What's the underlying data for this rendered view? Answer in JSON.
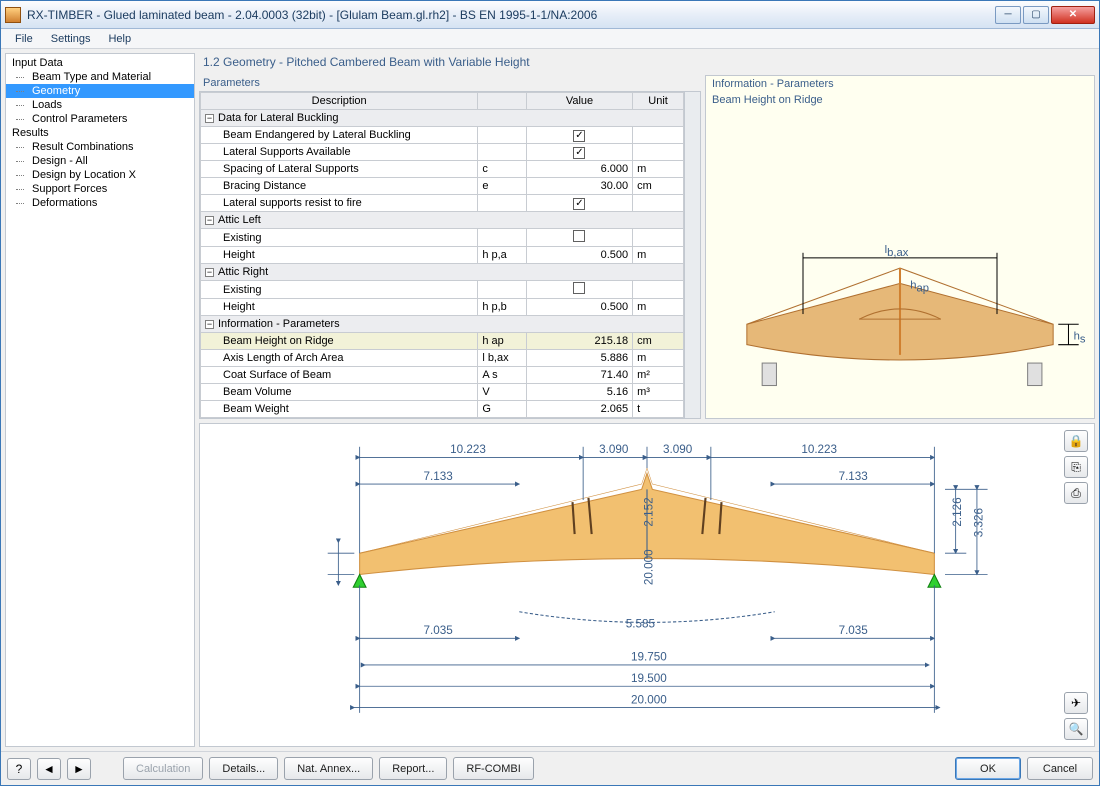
{
  "window": {
    "title": "RX-TIMBER - Glued laminated beam - 2.04.0003 (32bit) - [Glulam Beam.gl.rh2] - BS EN 1995-1-1/NA:2006"
  },
  "menu": {
    "file": "File",
    "settings": "Settings",
    "help": "Help"
  },
  "nav": {
    "input": "Input Data",
    "items_input": [
      "Beam Type and Material",
      "Geometry",
      "Loads",
      "Control Parameters"
    ],
    "results": "Results",
    "items_results": [
      "Result Combinations",
      "Design - All",
      "Design by Location X",
      "Support Forces",
      "Deformations"
    ]
  },
  "page": {
    "title": "1.2 Geometry  -  Pitched Cambered Beam with Variable Height",
    "parameters": "Parameters"
  },
  "cols": {
    "desc": "Description",
    "sym": "",
    "val": "Value",
    "unit": "Unit"
  },
  "groups": {
    "lateral": "Data for Lateral Buckling",
    "atticL": "Attic Left",
    "atticR": "Attic Right",
    "info": "Information - Parameters"
  },
  "rows": {
    "endangered": {
      "d": "Beam Endangered by Lateral Buckling",
      "cb": true
    },
    "supports_avail": {
      "d": "Lateral Supports Available",
      "cb": true
    },
    "spacing": {
      "d": "Spacing of Lateral Supports",
      "s": "c",
      "v": "6.000",
      "u": "m"
    },
    "bracing": {
      "d": "Bracing Distance",
      "s": "e",
      "v": "30.00",
      "u": "cm"
    },
    "fire": {
      "d": "Lateral supports resist to fire",
      "cb": true
    },
    "aL_exist": {
      "d": "Existing",
      "cb": false
    },
    "aL_height": {
      "d": "Height",
      "s": "h p,a",
      "v": "0.500",
      "u": "m"
    },
    "aR_exist": {
      "d": "Existing",
      "cb": false
    },
    "aR_height": {
      "d": "Height",
      "s": "h p,b",
      "v": "0.500",
      "u": "m"
    },
    "ridge": {
      "d": "Beam Height on Ridge",
      "s": "h ap",
      "v": "215.18",
      "u": "cm"
    },
    "axis": {
      "d": "Axis Length of Arch Area",
      "s": "l b,ax",
      "v": "5.886",
      "u": "m"
    },
    "coat": {
      "d": "Coat Surface of Beam",
      "s": "A s",
      "v": "71.40",
      "u": "m²"
    },
    "vol": {
      "d": "Beam Volume",
      "s": "V",
      "v": "5.16",
      "u": "m³"
    },
    "weight": {
      "d": "Beam Weight",
      "s": "G",
      "v": "2.065",
      "u": "t"
    }
  },
  "info": {
    "title": "Information - Parameters",
    "sub": "Beam Height on Ridge",
    "labels": {
      "lbax": "l",
      "lbax_sub": "b,ax",
      "hap": "h",
      "hap_sub": "ap",
      "hs": "h",
      "hs_sub": "s"
    }
  },
  "dims": {
    "top": [
      "10.223",
      "3.090",
      "3.090",
      "10.223"
    ],
    "mid": [
      "7.133",
      "7.133"
    ],
    "bot_low": [
      "7.035",
      "5.585",
      "7.035"
    ],
    "overall": [
      "19.750",
      "19.500",
      "20.000"
    ],
    "hridge": "2.152",
    "r": "20.000",
    "h_right": [
      "2.126",
      "3.326"
    ]
  },
  "buttons": {
    "calc": "Calculation",
    "details": "Details...",
    "annex": "Nat. Annex...",
    "report": "Report...",
    "combi": "RF-COMBI",
    "ok": "OK",
    "cancel": "Cancel"
  }
}
